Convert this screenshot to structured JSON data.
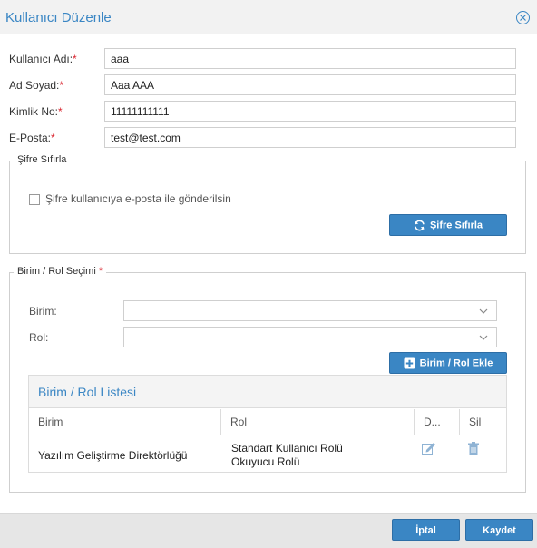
{
  "dialog": {
    "title": "Kullanıcı Düzenle",
    "close_icon": "close-circle-icon"
  },
  "form": {
    "username": {
      "label": "Kullanıcı Adı:",
      "required_mark": "*",
      "value": "aaa"
    },
    "fullname": {
      "label": "Ad Soyad:",
      "required_mark": "*",
      "value": "Aaa AAA"
    },
    "identity": {
      "label": "Kimlik No:",
      "required_mark": "*",
      "value": "11111111111"
    },
    "email": {
      "label": "E-Posta:",
      "required_mark": "*",
      "value": "test@test.com"
    }
  },
  "password_reset": {
    "legend": "Şifre Sıfırla",
    "checkbox_label": "Şifre kullanıcıya e-posta ile gönderilsin",
    "checked": false,
    "button_label": "Şifre Sıfırla",
    "button_icon": "refresh-icon"
  },
  "unit_role": {
    "legend": "Birim / Rol Seçimi",
    "required_mark": "*",
    "unit_label": "Birim:",
    "unit_value": "",
    "role_label": "Rol:",
    "role_value": "",
    "add_button_label": "Birim / Rol Ekle",
    "add_button_icon": "plus-square-icon",
    "list": {
      "title": "Birim / Rol Listesi",
      "columns": [
        "Birim",
        "Rol",
        "D...",
        "Sil"
      ],
      "rows": [
        {
          "unit": "Yazılım Geliştirme Direktörlüğü",
          "roles": [
            "Standart Kullanıcı Rolü",
            "Okuyucu Rolü"
          ],
          "edit_icon": "edit-icon",
          "delete_icon": "trash-icon"
        }
      ]
    }
  },
  "footer": {
    "cancel_label": "İptal",
    "save_label": "Kaydet"
  },
  "colors": {
    "accent": "#3a86c4",
    "required": "#d9232d",
    "titlebar_bg": "#f2f2f2",
    "footer_bg": "#e6e6e6"
  }
}
